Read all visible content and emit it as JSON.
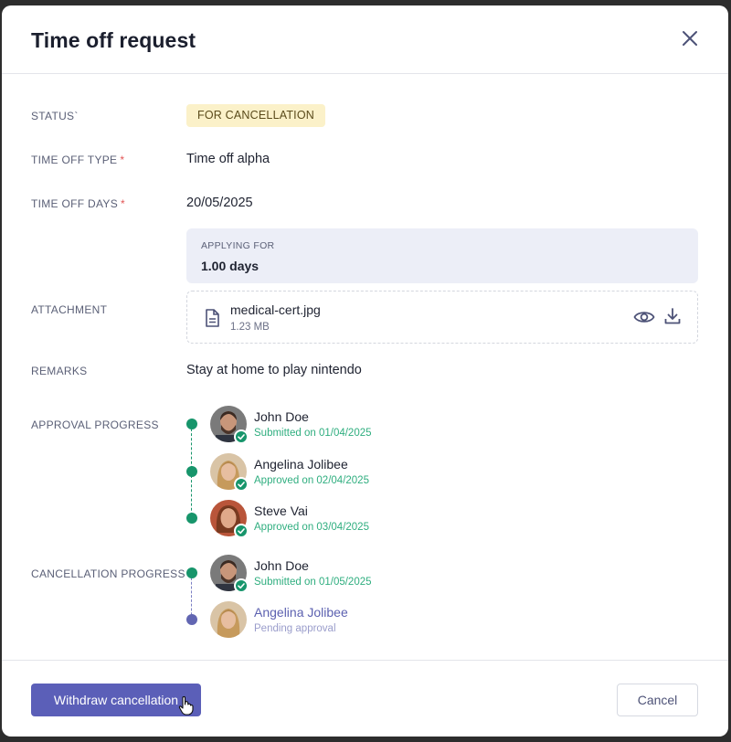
{
  "modal": {
    "title": "Time off request",
    "close_icon": "close-icon"
  },
  "status": {
    "label": "STATUS`",
    "value": "FOR CANCELLATION",
    "badge_color": "#fbf1c9"
  },
  "time_off_type": {
    "label": "TIME OFF TYPE",
    "required_mark": "*",
    "value": "Time off alpha"
  },
  "time_off_days": {
    "label": "TIME OFF DAYS",
    "required_mark": "*",
    "value": "20/05/2025",
    "applying_for_label": "APPLYING FOR",
    "applying_for_value": "1.00 days"
  },
  "attachment": {
    "label": "ATTACHMENT",
    "file_name": "medical-cert.jpg",
    "file_size": "1.23 MB",
    "file_icon": "file-icon",
    "view_icon": "eye-icon",
    "download_icon": "download-icon"
  },
  "remarks": {
    "label": "REMARKS",
    "value": "Stay at home to play nintendo"
  },
  "approval_progress": {
    "label": "APPROVAL PROGRESS",
    "steps": [
      {
        "name": "John Doe",
        "status": "Submitted on 01/04/2025",
        "state": "done"
      },
      {
        "name": "Angelina Jolibee",
        "status": "Approved on 02/04/2025",
        "state": "done"
      },
      {
        "name": "Steve Vai",
        "status": "Approved on 03/04/2025",
        "state": "done"
      }
    ]
  },
  "cancellation_progress": {
    "label": "CANCELLATION PROGRESS",
    "steps": [
      {
        "name": "John Doe",
        "status": "Submitted on 01/05/2025",
        "state": "done"
      },
      {
        "name": "Angelina Jolibee",
        "status": "Pending approval",
        "state": "pending"
      }
    ]
  },
  "footer": {
    "primary_label": "Withdraw cancellation",
    "secondary_label": "Cancel"
  },
  "colors": {
    "primary": "#5b5fb8",
    "success": "#17956b",
    "pending": "#6266b2"
  }
}
